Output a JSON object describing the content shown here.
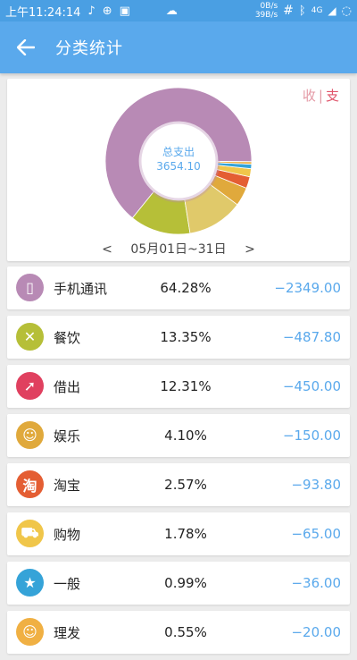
{
  "status_bar": {
    "time": "上午11:24:14",
    "net_up": "0B/s",
    "net_down": "39B/s",
    "network": "4G"
  },
  "app_bar": {
    "title": "分类统计"
  },
  "chart_toggle": {
    "income": "收",
    "separator": "|",
    "expense": "支"
  },
  "summary": {
    "label": "总支出",
    "total": "3654.10"
  },
  "date_range": {
    "prev": "<",
    "text": "05月01日~31日",
    "next": ">"
  },
  "chart_data": {
    "type": "pie",
    "variant": "donut",
    "categories": [
      "手机通讯",
      "餐饮",
      "借出",
      "娱乐",
      "淘宝",
      "购物",
      "一般",
      "理发"
    ],
    "values": [
      2349.0,
      487.8,
      450.0,
      150.0,
      93.8,
      65.0,
      36.0,
      20.0
    ],
    "colors": [
      "#b88ab5",
      "#b6bf38",
      "#e0c96a",
      "#e0a93c",
      "#e45e33",
      "#f0c64a",
      "#35a3d8",
      "#f0b043"
    ]
  },
  "categories": [
    {
      "name": "手机通讯",
      "percent": "64.28%",
      "amount": "−2349.00",
      "icon": "phone-icon",
      "glyph": "▯",
      "color": "#b88ab5"
    },
    {
      "name": "餐饮",
      "percent": "13.35%",
      "amount": "−487.80",
      "icon": "fork-knife-icon",
      "glyph": "✕",
      "color": "#b6bf38"
    },
    {
      "name": "借出",
      "percent": "12.31%",
      "amount": "−450.00",
      "icon": "lend-arrow-icon",
      "glyph": "➚",
      "color": "#e0405f"
    },
    {
      "name": "娱乐",
      "percent": "4.10%",
      "amount": "−150.00",
      "icon": "smile-face-icon",
      "glyph": "☺",
      "color": "#e0a93c"
    },
    {
      "name": "淘宝",
      "percent": "2.57%",
      "amount": "−93.80",
      "icon": "taobao-icon",
      "glyph": "淘",
      "color": "#e45e33"
    },
    {
      "name": "购物",
      "percent": "1.78%",
      "amount": "−65.00",
      "icon": "cart-icon",
      "glyph": "⛟",
      "color": "#f0c64a"
    },
    {
      "name": "一般",
      "percent": "0.99%",
      "amount": "−36.00",
      "icon": "star-icon",
      "glyph": "★",
      "color": "#35a3d8"
    },
    {
      "name": "理发",
      "percent": "0.55%",
      "amount": "−20.00",
      "icon": "haircut-icon",
      "glyph": "☺",
      "color": "#f0b043"
    }
  ]
}
